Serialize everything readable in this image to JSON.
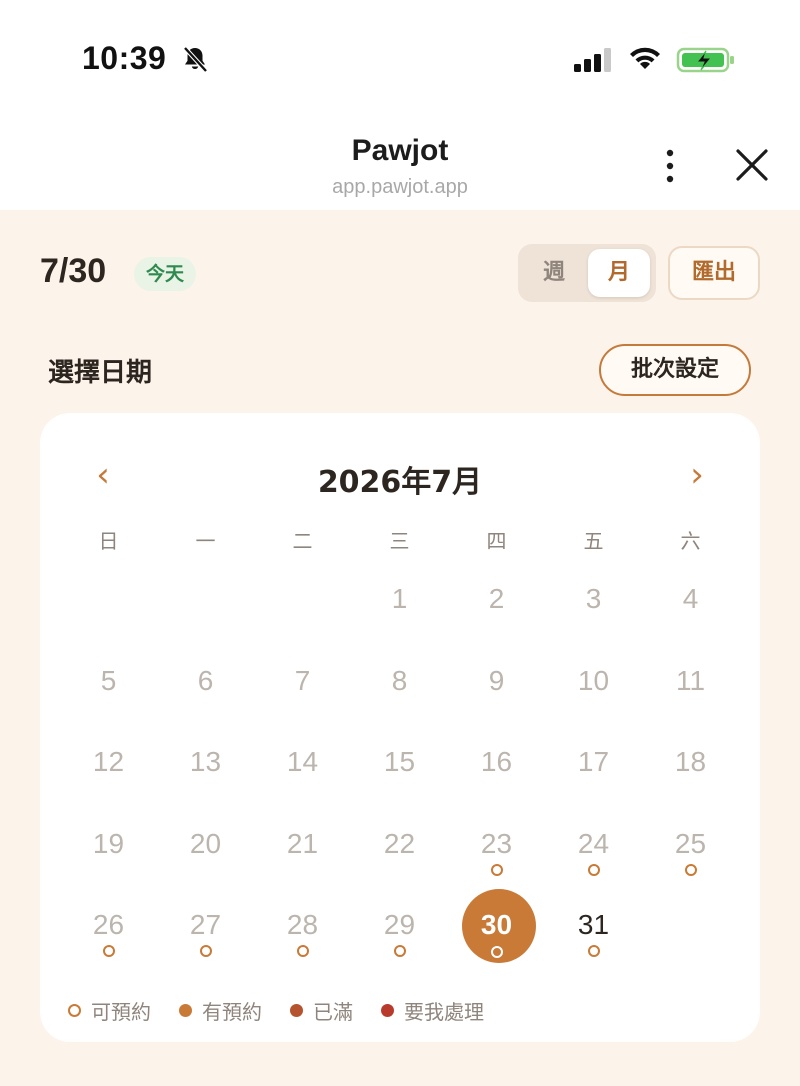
{
  "status_bar": {
    "time": "10:39"
  },
  "browser": {
    "title": "Pawjot",
    "url": "app.pawjot.app"
  },
  "header": {
    "date": "7/30",
    "today_badge": "今天",
    "view_toggle": {
      "week": "週",
      "month": "月",
      "selected": "月"
    },
    "export_label": "匯出"
  },
  "section": {
    "title": "選擇日期",
    "batch_label": "批次設定"
  },
  "calendar": {
    "month_title": "2026年7月",
    "prev": "‹",
    "next": "›",
    "weekdays": [
      "日",
      "一",
      "二",
      "三",
      "四",
      "五",
      "六"
    ],
    "weeks": [
      [
        null,
        null,
        null,
        1,
        2,
        3,
        4
      ],
      [
        5,
        6,
        7,
        8,
        9,
        10,
        11
      ],
      [
        12,
        13,
        14,
        15,
        16,
        17,
        18
      ],
      [
        19,
        20,
        21,
        22,
        23,
        24,
        25
      ],
      [
        26,
        27,
        28,
        29,
        30,
        31,
        null
      ]
    ],
    "selected_day": 30,
    "active_days": [
      30,
      31
    ],
    "available_days": [
      23,
      24,
      25,
      26,
      27,
      28,
      29,
      30,
      31
    ]
  },
  "legend": [
    {
      "label": "可預約",
      "style": "outline",
      "color": "#c97a36"
    },
    {
      "label": "有預約",
      "style": "filled",
      "color": "#c97a36"
    },
    {
      "label": "已滿",
      "style": "filled",
      "color": "#b5532e"
    },
    {
      "label": "要我處理",
      "style": "filled",
      "color": "#b83a2c"
    }
  ],
  "colors": {
    "accent": "#c97a36",
    "background": "#fcf3ea",
    "today_green": "#2e8a4e"
  }
}
